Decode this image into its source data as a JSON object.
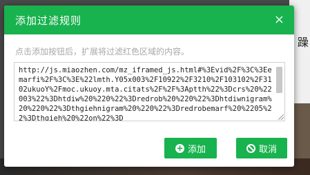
{
  "background": {
    "right_char": "躁"
  },
  "dialog": {
    "title": "添加过滤规则",
    "close_label": "×",
    "hint": "点击添加按钮后，扩展将过滤红色区域的内容。",
    "textarea_value": "http://js.miaozhen.com/mz_iframed_js.html#%3Evid%2F%3C%3Eemarfi%2F%3C%3E%22lmth.Y05x003%2F10922%2F3210%2F103102%2F3102ukuoY%2Fmoc.ukuoy.mta.citats%2F%2F%3Aptth%22%3Dcrs%20%22003%22%3Dhtdiw%20%220%22%3Dredrob%20%220%22%3Dhtdiwnigram%20%220%22%3Dthgiehnigram%20%220%22%3Dredrobemarf%20%2205%22%3Dthgieh%20%22on%22%3D",
    "add_label": "添加",
    "cancel_label": "取消",
    "accent": "#18b24e"
  },
  "icons": {
    "add": "plus-circle-icon",
    "cancel": "ban-icon",
    "close": "close-icon"
  }
}
